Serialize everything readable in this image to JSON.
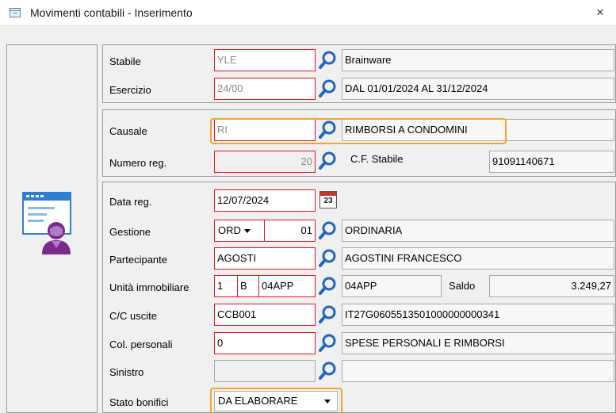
{
  "window": {
    "title": "Movimenti contabili - Inserimento",
    "close_glyph": "×"
  },
  "stabile": {
    "label": "Stabile",
    "code": "YLE",
    "desc": "Brainware"
  },
  "esercizio": {
    "label": "Esercizio",
    "code": "24/00",
    "desc": "DAL 01/01/2024 AL 31/12/2024"
  },
  "causale": {
    "label": "Causale",
    "code": "RI",
    "desc": "RIMBORSI A CONDOMINI"
  },
  "numero_reg": {
    "label": "Numero reg.",
    "value": "20",
    "cf_label": "C.F. Stabile",
    "cf_value": "91091140671"
  },
  "data_reg": {
    "label": "Data reg.",
    "value": "12/07/2024",
    "calendar_day": "23"
  },
  "gestione": {
    "label": "Gestione",
    "select": "ORD",
    "num": "01",
    "desc": "ORDINARIA"
  },
  "partecipante": {
    "label": "Partecipante",
    "code": "AGOSTI",
    "desc": "AGOSTINI FRANCESCO"
  },
  "unita": {
    "label": "Unità immobiliare",
    "a": "1",
    "b": "B",
    "c": "04APP",
    "desc": "04APP",
    "saldo_label": "Saldo",
    "saldo_value": "3.249,27"
  },
  "cc_uscite": {
    "label": "C/C uscite",
    "code": "CCB001",
    "desc": "IT27G0605513501000000000341"
  },
  "col_personali": {
    "label": "Col. personali",
    "code": "0",
    "desc": "SPESE PERSONALI E RIMBORSI"
  },
  "sinistro": {
    "label": "Sinistro",
    "code": "",
    "desc": ""
  },
  "stato_bonifici": {
    "label": "Stato bonifici",
    "value": "DA ELABORARE"
  },
  "colors": {
    "required_border": "#e0141e",
    "highlight": "#f0a72b",
    "panel_bg": "#f0f0f0"
  }
}
